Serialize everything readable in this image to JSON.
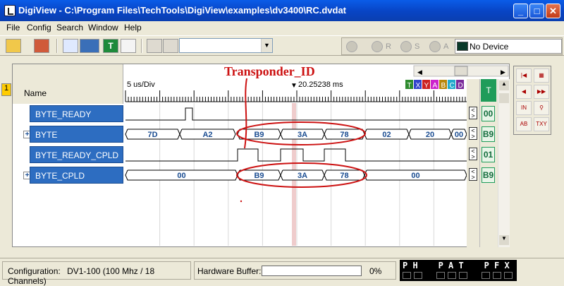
{
  "window": {
    "title": "DigiView - C:\\Program Files\\TechTools\\DigiView\\examples\\dv3400\\RC.dvdat",
    "min_glyph": "_",
    "max_glyph": "□",
    "close_glyph": "✕"
  },
  "menu": {
    "file": "File",
    "config": "Config",
    "search": "Search",
    "window": "Window",
    "help": "Help"
  },
  "toolbar": {
    "combo_value": "",
    "play_labels": [
      "R",
      "S",
      "A"
    ],
    "device_status": "No Device"
  },
  "waveform": {
    "group_number": "1",
    "name_header": "Name",
    "scale": "5 us/Div",
    "cursor_time": "20.25238 ms",
    "trigger_letters": [
      "T",
      "X",
      "Y",
      "A",
      "B",
      "C",
      "D"
    ],
    "trigger_colors": [
      "#2e8b2e",
      "#3344cc",
      "#cc2222",
      "#cc22cc",
      "#b8860b",
      "#22aacc",
      "#7a2a9a"
    ],
    "annotation": "Transponder_ID",
    "annotation_color": "#cc1111",
    "t_header": "T",
    "signals": [
      {
        "name": "BYTE_READY",
        "expandable": false,
        "t_value": "00"
      },
      {
        "name": "BYTE",
        "expandable": true,
        "t_value": "B9"
      },
      {
        "name": "BYTE_READY_CPLD",
        "expandable": false,
        "t_value": "01"
      },
      {
        "name": "BYTE_CPLD",
        "expandable": true,
        "t_value": "B9"
      }
    ],
    "byte_values": [
      "7D",
      "A2",
      "B9",
      "3A",
      "78",
      "02",
      "20",
      "00"
    ],
    "byte_cpld_values": [
      "00",
      "B9",
      "3A",
      "78",
      "00"
    ]
  },
  "status": {
    "configuration_label": "Configuration:",
    "configuration_value": "DV1-100 (100 Mhz / 18 Channels)",
    "buffer_label": "Hardware Buffer:",
    "buffer_percent": "0%",
    "buffer_fill": 0,
    "indicator_top": "P H    P A T    P F X"
  }
}
